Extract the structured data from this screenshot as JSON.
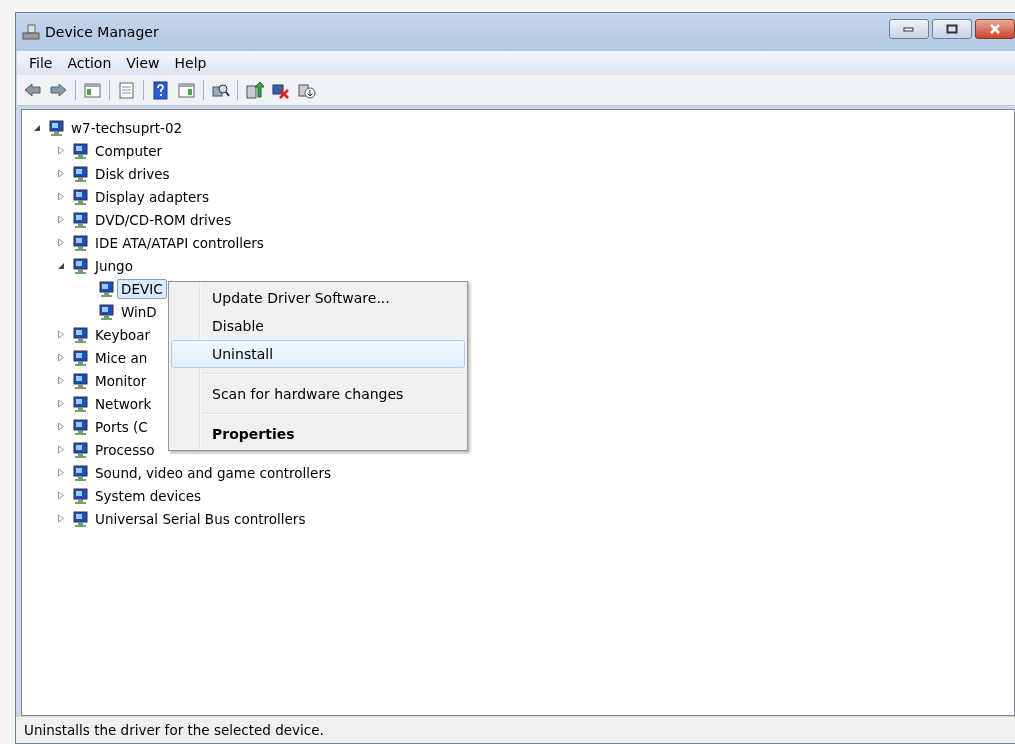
{
  "window": {
    "title": "Device Manager"
  },
  "menu": [
    "File",
    "Action",
    "View",
    "Help"
  ],
  "tree": {
    "label": "w7-techsuprt-02",
    "expanded": true,
    "children": [
      {
        "label": "Computer",
        "expanded": false
      },
      {
        "label": "Disk drives",
        "expanded": false
      },
      {
        "label": "Display adapters",
        "expanded": false
      },
      {
        "label": "DVD/CD-ROM drives",
        "expanded": false
      },
      {
        "label": "IDE ATA/ATAPI controllers",
        "expanded": false
      },
      {
        "label": "Jungo",
        "expanded": true,
        "children": [
          {
            "label": "DEVIC",
            "selected": true
          },
          {
            "label": "WinD",
            "selected": false
          }
        ]
      },
      {
        "label": "Keyboar",
        "expanded": false
      },
      {
        "label": "Mice an",
        "expanded": false
      },
      {
        "label": "Monitor",
        "expanded": false
      },
      {
        "label": "Network",
        "expanded": false
      },
      {
        "label": "Ports (C",
        "expanded": false
      },
      {
        "label": "Processo",
        "expanded": false
      },
      {
        "label": "Sound, video and game controllers",
        "expanded": false
      },
      {
        "label": "System devices",
        "expanded": false
      },
      {
        "label": "Universal Serial Bus controllers",
        "expanded": false
      }
    ]
  },
  "context_menu": [
    {
      "label": "Update Driver Software...",
      "kind": "item",
      "selected": false,
      "separator_after": false
    },
    {
      "label": "Disable",
      "kind": "item",
      "selected": false,
      "separator_after": false
    },
    {
      "label": "Uninstall",
      "kind": "item",
      "selected": true,
      "separator_after": true
    },
    {
      "label": "Scan for hardware changes",
      "kind": "item",
      "selected": false,
      "separator_after": true
    },
    {
      "label": "Properties",
      "kind": "default",
      "selected": false,
      "separator_after": false
    }
  ],
  "status_bar": "Uninstalls the driver for the selected device."
}
